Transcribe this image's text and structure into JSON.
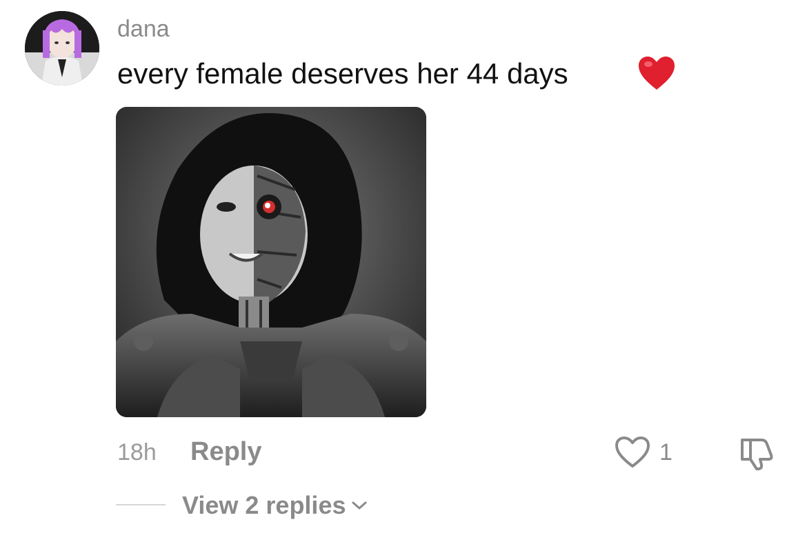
{
  "comment": {
    "username": "dana",
    "text": "every female deserves her 44 days",
    "emoji": "heart-emoji",
    "timestamp": "18h",
    "reply_label": "Reply",
    "like_count": "1",
    "view_replies_label": "View 2 replies"
  },
  "icons": {
    "like": "heart-outline-icon",
    "dislike": "thumbs-down-icon",
    "expand": "chevron-down-icon"
  },
  "colors": {
    "text_primary": "#111111",
    "text_secondary": "#8a8a8a",
    "heart_red": "#e0202e"
  }
}
